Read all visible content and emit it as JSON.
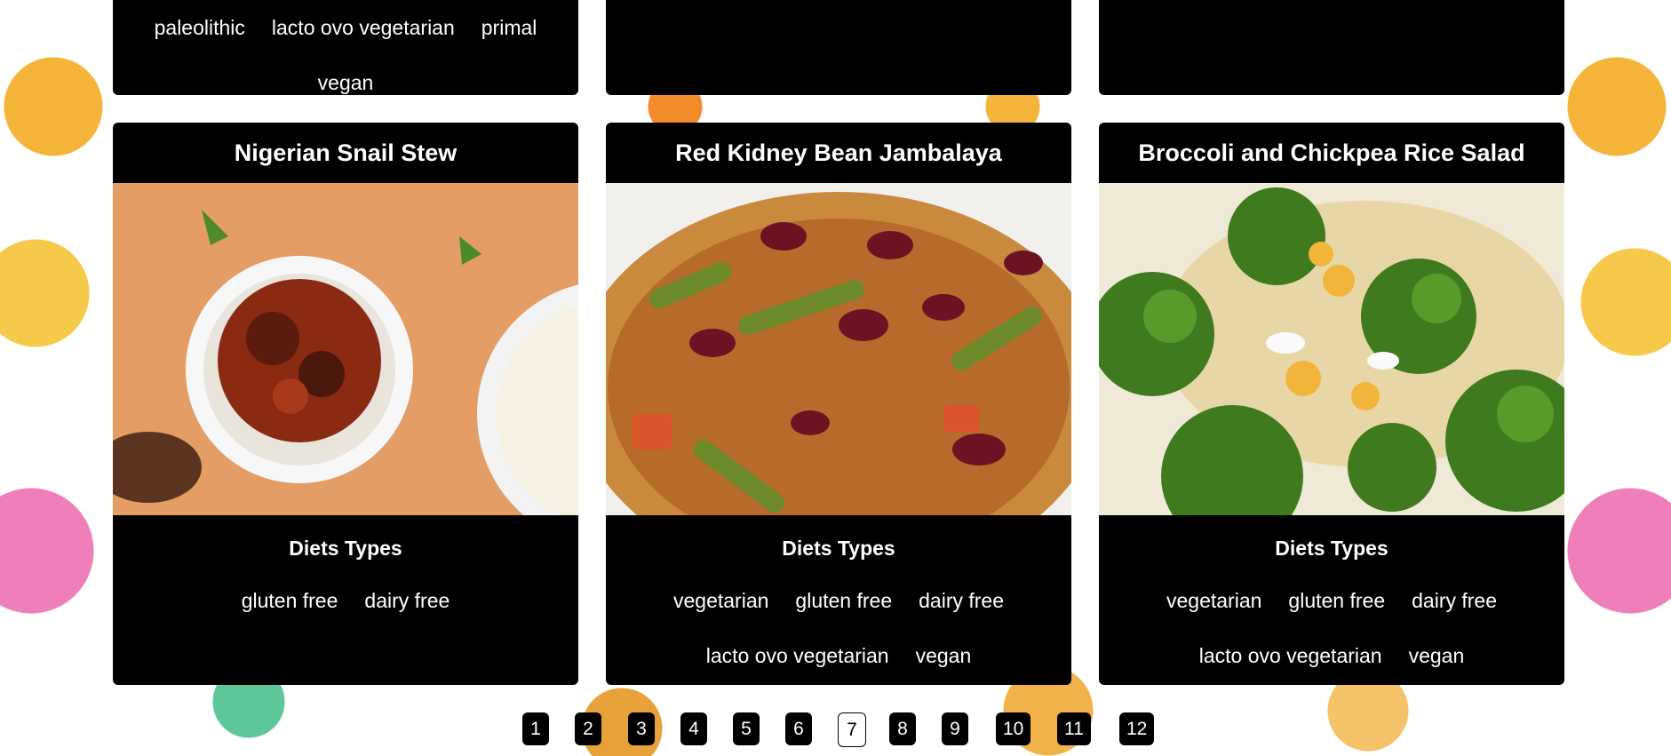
{
  "top_cards": [
    {
      "tags": [
        "paleolithic",
        "lacto ovo vegetarian",
        "primal",
        "vegan"
      ]
    },
    {
      "tags": []
    },
    {
      "tags": []
    }
  ],
  "recipes": [
    {
      "title": "Nigerian Snail Stew",
      "diets_heading": "Diets Types",
      "tags": [
        "gluten free",
        "dairy free"
      ],
      "image_alt": "snail stew in white bowl with rice"
    },
    {
      "title": "Red Kidney Bean Jambalaya",
      "diets_heading": "Diets Types",
      "tags": [
        "vegetarian",
        "gluten free",
        "dairy free",
        "lacto ovo vegetarian",
        "vegan"
      ],
      "image_alt": "kidney bean jambalaya with green beans"
    },
    {
      "title": "Broccoli and Chickpea Rice Salad",
      "diets_heading": "Diets Types",
      "tags": [
        "vegetarian",
        "gluten free",
        "dairy free",
        "lacto ovo vegetarian",
        "vegan"
      ],
      "image_alt": "broccoli chickpea rice salad"
    }
  ],
  "pagination": {
    "pages": [
      "1",
      "2",
      "3",
      "4",
      "5",
      "6",
      "7",
      "8",
      "9",
      "10",
      "11",
      "12"
    ],
    "current": "7"
  }
}
